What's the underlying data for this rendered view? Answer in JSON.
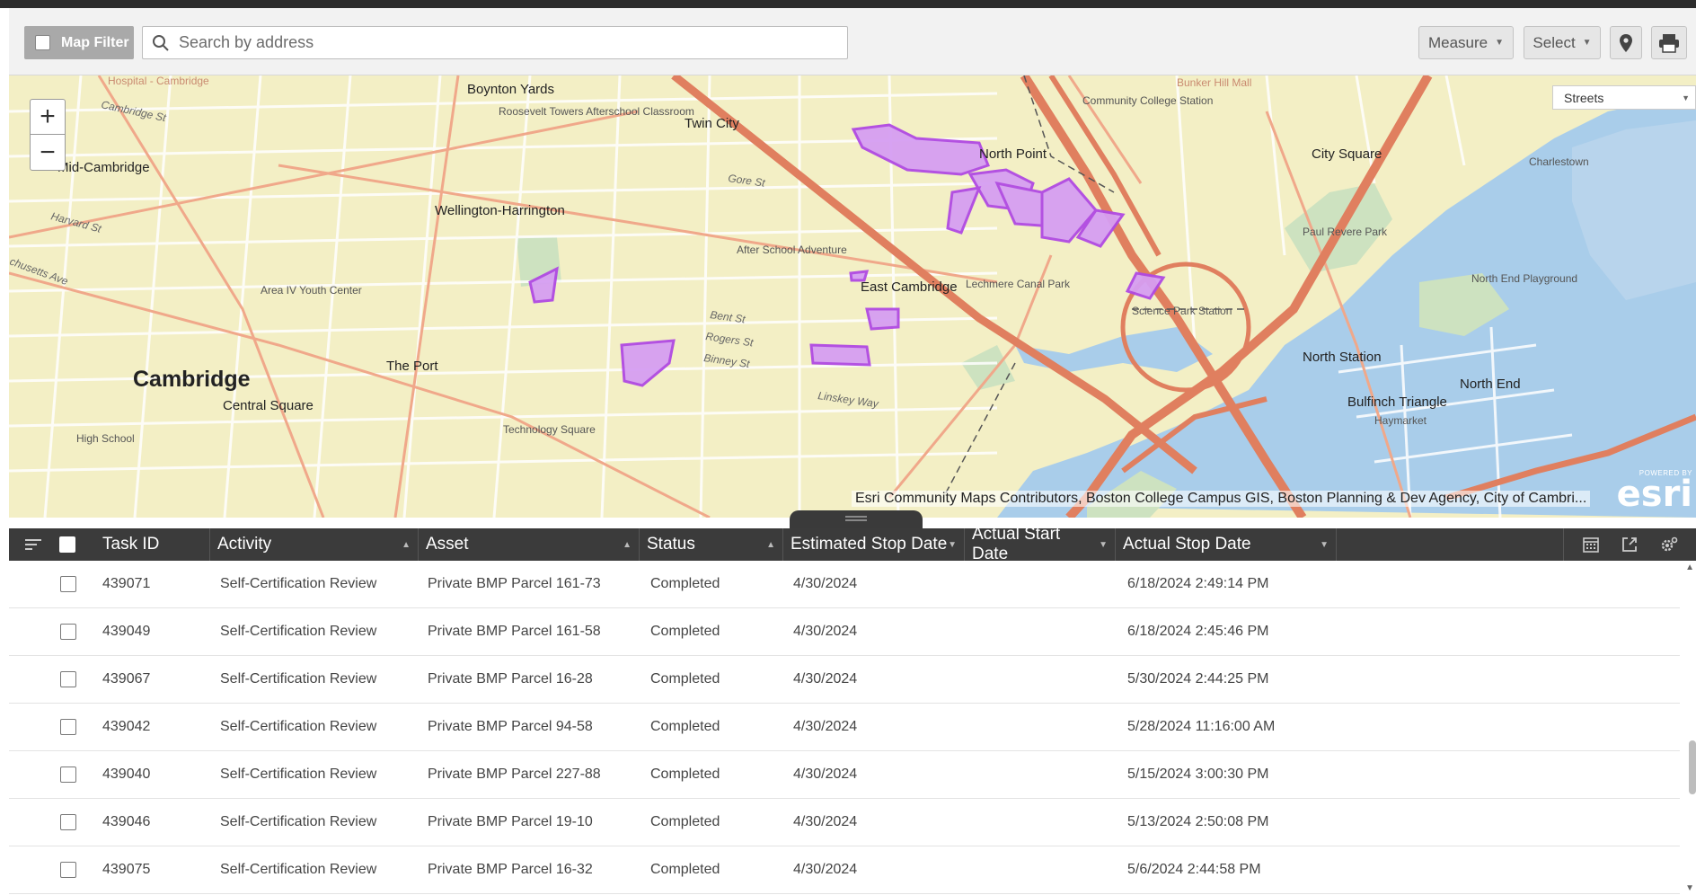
{
  "toolbar": {
    "map_filter_label": "Map Filter",
    "search_placeholder": "Search by address",
    "measure_label": "Measure",
    "select_label": "Select"
  },
  "map": {
    "basemap_selected": "Streets",
    "attribution": "Esri Community Maps Contributors, Boston College Campus GIS, Boston Planning & Dev Agency, City of Cambri...",
    "esri_powered": "POWERED BY",
    "esri_logo": "esri",
    "labels": {
      "boynton_yards": "Boynton Yards",
      "roosevelt": "Roosevelt Towers Afterschool Classroom",
      "twin_city": "Twin City",
      "north_point": "North Point",
      "community_college": "Community College Station",
      "bunker_hill": "Bunker Hill Mall",
      "city_square": "City Square",
      "charlestown": "Charlestown",
      "mid_cambridge": "Mid-Cambridge",
      "wellington": "Wellington-Harrington",
      "after_school": "After School Adventure",
      "east_cambridge": "East Cambridge",
      "lechmere_canal": "Lechmere Canal Park",
      "paul_revere": "Paul Revere Park",
      "north_end_playground": "North End Playground",
      "science_park": "Science Park Station",
      "north_station": "North Station",
      "north_end": "North End",
      "bulfinch": "Bulfinch Triangle",
      "area_iv": "Area IV Youth Center",
      "the_port": "The Port",
      "cambridge": "Cambridge",
      "central_square": "Central Square",
      "high_school": "High School",
      "technology_square": "Technology Square",
      "hospital": "Hospital - Cambridge",
      "cambridge_st": "Cambridge St",
      "harvard_st": "Harvard St",
      "mass_ave": "chusetts Ave",
      "gore_st": "Gore St",
      "bent_st": "Bent St",
      "rogers_st": "Rogers St",
      "binney_st": "Binney St",
      "linskey_way": "Linskey Way",
      "haymarket": "Haymarket"
    }
  },
  "grid": {
    "columns": [
      "Task ID",
      "Activity",
      "Asset",
      "Status",
      "Estimated Stop Date",
      "Actual Start Date",
      "Actual Stop Date"
    ],
    "rows": [
      {
        "task_id": "439071",
        "activity": "Self-Certification Review",
        "asset": "Private BMP Parcel 161-73",
        "status": "Completed",
        "est_stop": "4/30/2024",
        "actual_start": "",
        "actual_stop": "6/18/2024 2:49:14 PM"
      },
      {
        "task_id": "439049",
        "activity": "Self-Certification Review",
        "asset": "Private BMP Parcel 161-58",
        "status": "Completed",
        "est_stop": "4/30/2024",
        "actual_start": "",
        "actual_stop": "6/18/2024 2:45:46 PM"
      },
      {
        "task_id": "439067",
        "activity": "Self-Certification Review",
        "asset": "Private BMP Parcel 16-28",
        "status": "Completed",
        "est_stop": "4/30/2024",
        "actual_start": "",
        "actual_stop": "5/30/2024 2:44:25 PM"
      },
      {
        "task_id": "439042",
        "activity": "Self-Certification Review",
        "asset": "Private BMP Parcel 94-58",
        "status": "Completed",
        "est_stop": "4/30/2024",
        "actual_start": "",
        "actual_stop": "5/28/2024 11:16:00 AM"
      },
      {
        "task_id": "439040",
        "activity": "Self-Certification Review",
        "asset": "Private BMP Parcel 227-88",
        "status": "Completed",
        "est_stop": "4/30/2024",
        "actual_start": "",
        "actual_stop": "5/15/2024 3:00:30 PM"
      },
      {
        "task_id": "439046",
        "activity": "Self-Certification Review",
        "asset": "Private BMP Parcel 19-10",
        "status": "Completed",
        "est_stop": "4/30/2024",
        "actual_start": "",
        "actual_stop": "5/13/2024 2:50:08 PM"
      },
      {
        "task_id": "439075",
        "activity": "Self-Certification Review",
        "asset": "Private BMP Parcel 16-32",
        "status": "Completed",
        "est_stop": "4/30/2024",
        "actual_start": "",
        "actual_stop": "5/6/2024 2:44:58 PM"
      }
    ]
  }
}
